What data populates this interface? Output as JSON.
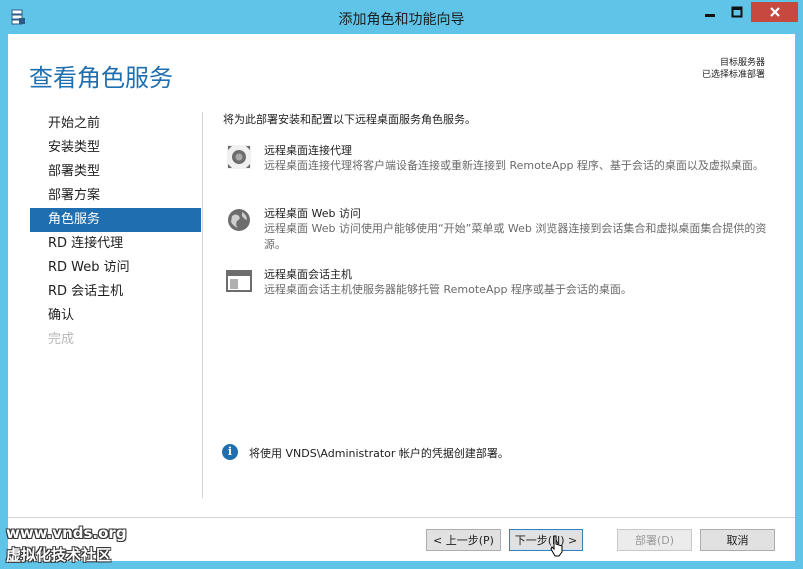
{
  "window": {
    "title": "添加角色和功能向导",
    "accent": "#5fc4e8",
    "close_color": "#c7483f"
  },
  "header": {
    "title": "查看角色服务",
    "destination_label": "目标服务器",
    "destination_value": "已选择标准部署"
  },
  "nav": {
    "items": [
      {
        "label": "开始之前",
        "state": "normal"
      },
      {
        "label": "安装类型",
        "state": "normal"
      },
      {
        "label": "部署类型",
        "state": "normal"
      },
      {
        "label": "部署方案",
        "state": "normal"
      },
      {
        "label": "角色服务",
        "state": "active"
      },
      {
        "label": "RD 连接代理",
        "state": "normal"
      },
      {
        "label": "RD Web 访问",
        "state": "normal"
      },
      {
        "label": "RD 会话主机",
        "state": "normal"
      },
      {
        "label": "确认",
        "state": "normal"
      },
      {
        "label": "完成",
        "state": "disabled"
      }
    ]
  },
  "main": {
    "intro": "将为此部署安装和配置以下远程桌面服务角色服务。",
    "services": [
      {
        "name": "远程桌面连接代理",
        "desc": "远程桌面连接代理将客户端设备连接或重新连接到 RemoteApp 程序、基于会话的桌面以及虚拟桌面。",
        "icon": "connection-broker-icon"
      },
      {
        "name": "远程桌面 Web 访问",
        "desc": "远程桌面 Web 访问使用户能够使用“开始”菜单或 Web 浏览器连接到会话集合和虚拟桌面集合提供的资源。",
        "icon": "globe-icon"
      },
      {
        "name": "远程桌面会话主机",
        "desc": "远程桌面会话主机使服务器能够托管 RemoteApp 程序或基于会话的桌面。",
        "icon": "window-icon"
      }
    ],
    "info_text": "将使用 VNDS\\Administrator 帐户的凭据创建部署。"
  },
  "footer": {
    "prev_label": "< 上一步(P)",
    "next_label": "下一步(N) >",
    "deploy_label": "部署(D)",
    "cancel_label": "取消"
  },
  "watermark": {
    "line1": "www.vnds.org",
    "line2": "虚拟化技术社区"
  }
}
